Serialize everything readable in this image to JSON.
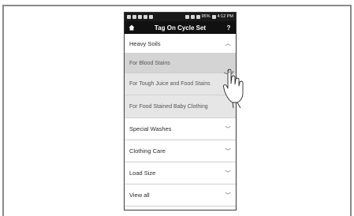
{
  "status_bar": {
    "battery": "95%",
    "time": "4:12 PM"
  },
  "header": {
    "title": "Tag On Cycle Set",
    "help_label": "?"
  },
  "categories": [
    {
      "label": "Heavy Soils",
      "expanded": true,
      "chevron": "chevron-up-icon",
      "items": [
        {
          "label": "For Blood Stains",
          "selected": true
        },
        {
          "label": "For Tough Juice and Food Stains"
        },
        {
          "label": "For Food Stained Baby Clothing"
        }
      ]
    },
    {
      "label": "Special Washes",
      "chevron": "chevron-down-icon"
    },
    {
      "label": "Clothing Care",
      "chevron": "chevron-down-icon"
    },
    {
      "label": "Load Size",
      "chevron": "chevron-down-icon"
    },
    {
      "label": "View all",
      "chevron": "chevron-down-icon"
    }
  ],
  "colors": {
    "header_bg": "#111111",
    "submenu_bg": "#e6e6e6",
    "submenu_selected_bg": "#d4d4d4"
  }
}
